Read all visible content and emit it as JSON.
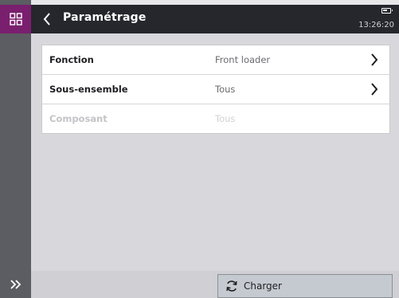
{
  "header": {
    "title": "Paramétrage",
    "time": "13:26:20"
  },
  "settings": {
    "rows": [
      {
        "label": "Fonction",
        "value": "Front loader",
        "enabled": true
      },
      {
        "label": "Sous-ensemble",
        "value": "Tous",
        "enabled": true
      },
      {
        "label": "Composant",
        "value": "Tous",
        "enabled": false
      }
    ]
  },
  "footer": {
    "load_label": "Charger"
  },
  "icons": {
    "app_grid": "grid-icon",
    "back": "chevron-left-icon",
    "expand": "double-chevron-right-icon",
    "battery": "battery-icon",
    "reload": "refresh-icon",
    "row_arrow": "chevron-right-icon"
  },
  "colors": {
    "accent": "#7a1f6e",
    "topbar": "#25272d",
    "rail": "#5b5d62"
  }
}
